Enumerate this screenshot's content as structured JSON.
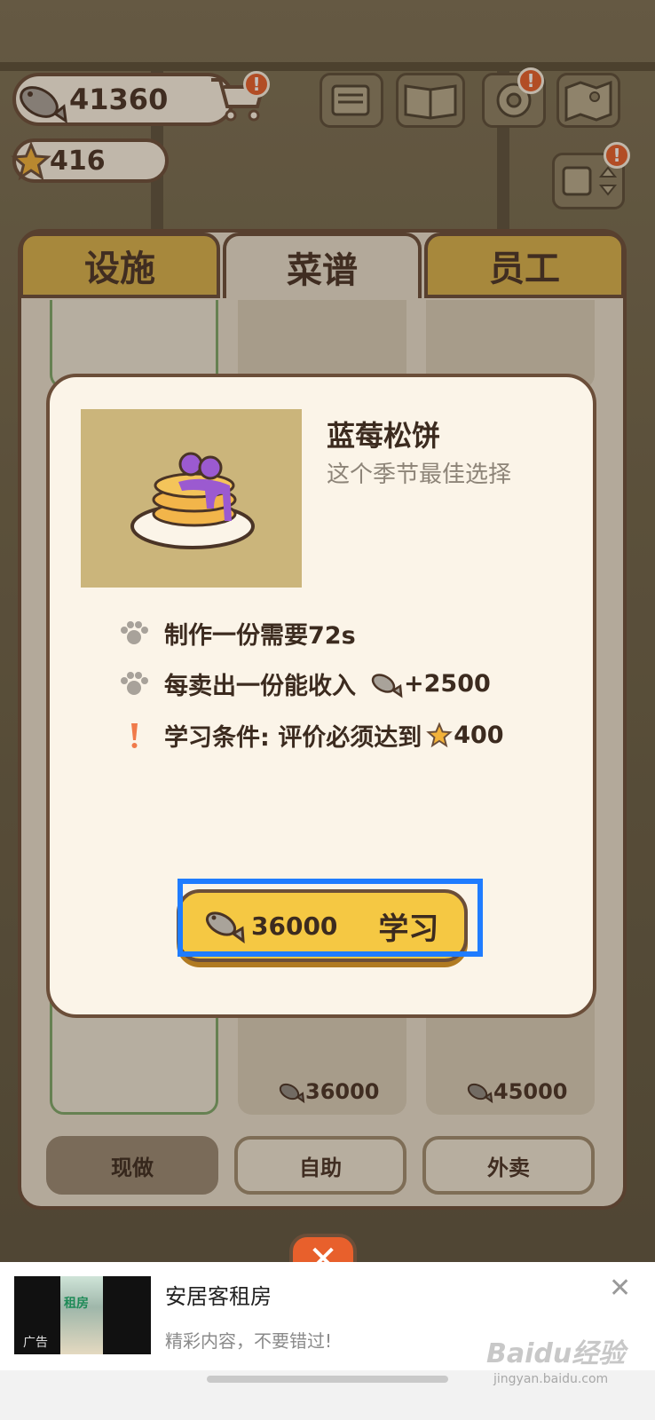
{
  "hud": {
    "fish_currency": "41360",
    "star_rating": "416",
    "cart_badge": "!",
    "settings_badge": "!",
    "sort_badge": "!"
  },
  "tabs": [
    {
      "label": "设施",
      "active": false
    },
    {
      "label": "菜谱",
      "active": true
    },
    {
      "label": "员工",
      "active": false
    }
  ],
  "recipe_cards": {
    "card_price_2": "36000",
    "card_price_3": "45000"
  },
  "modes": [
    {
      "label": "现做",
      "active": true
    },
    {
      "label": "自助",
      "active": false
    },
    {
      "label": "外卖",
      "active": false
    }
  ],
  "dialog": {
    "dish_name": "蓝莓松饼",
    "dish_subtitle": "这个季节最佳选择",
    "cook_time": "制作一份需要72s",
    "income_label": "每卖出一份能收入",
    "income_value": "+2500",
    "requirement_label": "学习条件: 评价必须达到",
    "requirement_value": "400",
    "learn_price": "36000",
    "learn_label": "学习"
  },
  "ad": {
    "thumb_text": "租房",
    "tag": "广告",
    "title": "安居客租房",
    "subtitle": "精彩内容，不要错过!",
    "close": "✕"
  },
  "watermark": {
    "brand": "Baidu经验",
    "url": "jingyan.baidu.com"
  },
  "colors": {
    "accent_gold": "#f5c843",
    "brown_outline": "#6b4e39",
    "highlight_blue": "#1f7cff",
    "badge_orange": "#e8602c"
  }
}
